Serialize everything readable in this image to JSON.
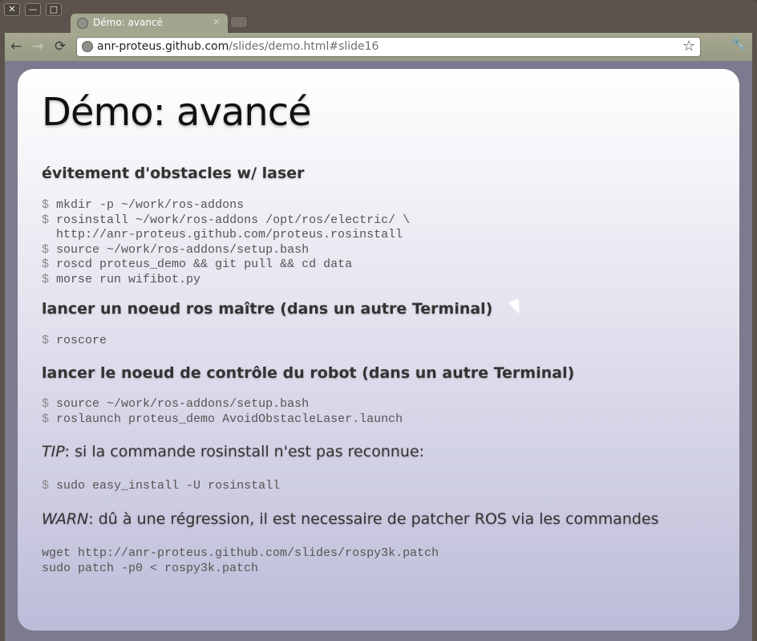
{
  "window": {
    "close": "✕",
    "minimize": "—",
    "maximize": "□"
  },
  "tab": {
    "title": "Démo: avancé",
    "close": "×"
  },
  "toolbar": {
    "back": "←",
    "forward": "→",
    "reload": "⟳",
    "url_host": "anr-proteus.github.com",
    "url_path": "/slides/demo.html#slide16",
    "star": "☆",
    "wrench": "🔧"
  },
  "slide": {
    "title": "Démo: avancé",
    "h1": "évitement d'obstacles w/ laser",
    "code1": [
      [
        "$",
        "mkdir -p ~/work/ros-addons"
      ],
      [
        "$",
        "rosinstall ~/work/ros-addons /opt/ros/electric/ \\"
      ],
      [
        "",
        "  http://anr-proteus.github.com/proteus.rosinstall"
      ],
      [
        "$",
        "source ~/work/ros-addons/setup.bash"
      ],
      [
        "$",
        "roscd proteus_demo && git pull && cd data"
      ],
      [
        "$",
        "morse run wifibot.py"
      ]
    ],
    "h2": "lancer un noeud ros maître (dans un autre Terminal)",
    "code2": [
      [
        "$",
        "roscore"
      ]
    ],
    "h3": "lancer le noeud de contrôle du robot (dans un autre Terminal)",
    "code3": [
      [
        "$",
        "source ~/work/ros-addons/setup.bash"
      ],
      [
        "$",
        "roslaunch proteus_demo AvoidObstacleLaser.launch"
      ]
    ],
    "tip_label": "TIP",
    "tip_text": ": si la commande rosinstall n'est pas reconnue:",
    "code4": [
      [
        "$",
        "sudo easy_install -U rosinstall"
      ]
    ],
    "warn_label": "WARN",
    "warn_text": ": dû à une régression, il est necessaire de patcher ROS via les commandes",
    "code5": [
      [
        "",
        "wget http://anr-proteus.github.com/slides/rospy3k.patch"
      ],
      [
        "",
        "sudo patch -p0 < rospy3k.patch"
      ]
    ]
  }
}
